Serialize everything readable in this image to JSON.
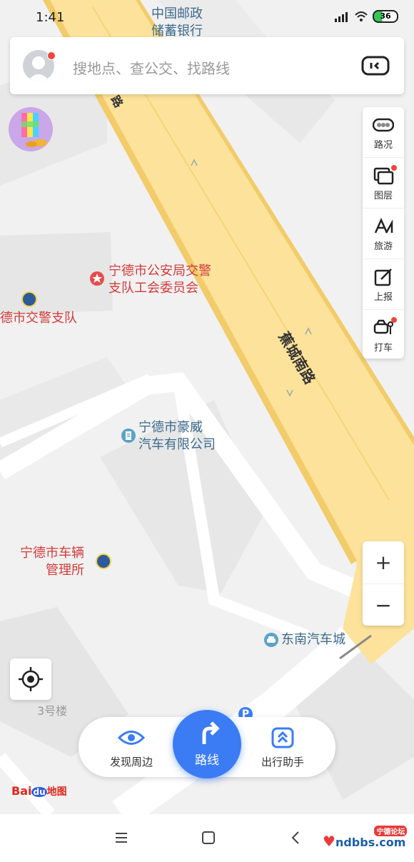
{
  "status_bar": {
    "time": "1:41",
    "battery": "36"
  },
  "search": {
    "placeholder": "搜地点、查公交、找路线"
  },
  "tools": [
    {
      "label": "路况",
      "icon": "traffic-icon",
      "badge": false
    },
    {
      "label": "图层",
      "icon": "layers-icon",
      "badge": true
    },
    {
      "label": "旅游",
      "icon": "tourism-icon",
      "badge": false
    },
    {
      "label": "上报",
      "icon": "report-icon",
      "badge": false
    },
    {
      "label": "打车",
      "icon": "taxi-icon",
      "badge": true
    }
  ],
  "zoom": {
    "in": "+",
    "out": "−"
  },
  "map": {
    "road_name": "蕉城南路",
    "pois": {
      "post_bank": "中国邮政\n储蓄银行",
      "traffic_union": "宁德市公安局交警\n支队工会委员会",
      "traffic_police": "德市交警支队",
      "haowei": "宁德市豪威\n汽车有限公司",
      "vehicle_mgmt": "宁德市车辆\n管理所",
      "southeast_auto": "东南汽车城",
      "building3": "3号楼"
    }
  },
  "bottom": {
    "discover": "发现周边",
    "route": "路线",
    "assistant": "出行助手"
  },
  "logo": {
    "text_bai": "Bai",
    "text_du": "du",
    "text_map": "地图"
  },
  "watermark": {
    "text": "ndbbs.com",
    "badge": "宁德论坛"
  },
  "colors": {
    "road": "#fce29a",
    "accent": "#3b7cf5",
    "poi_red": "#d23a3a",
    "poi_blue": "#3c6a8c"
  }
}
